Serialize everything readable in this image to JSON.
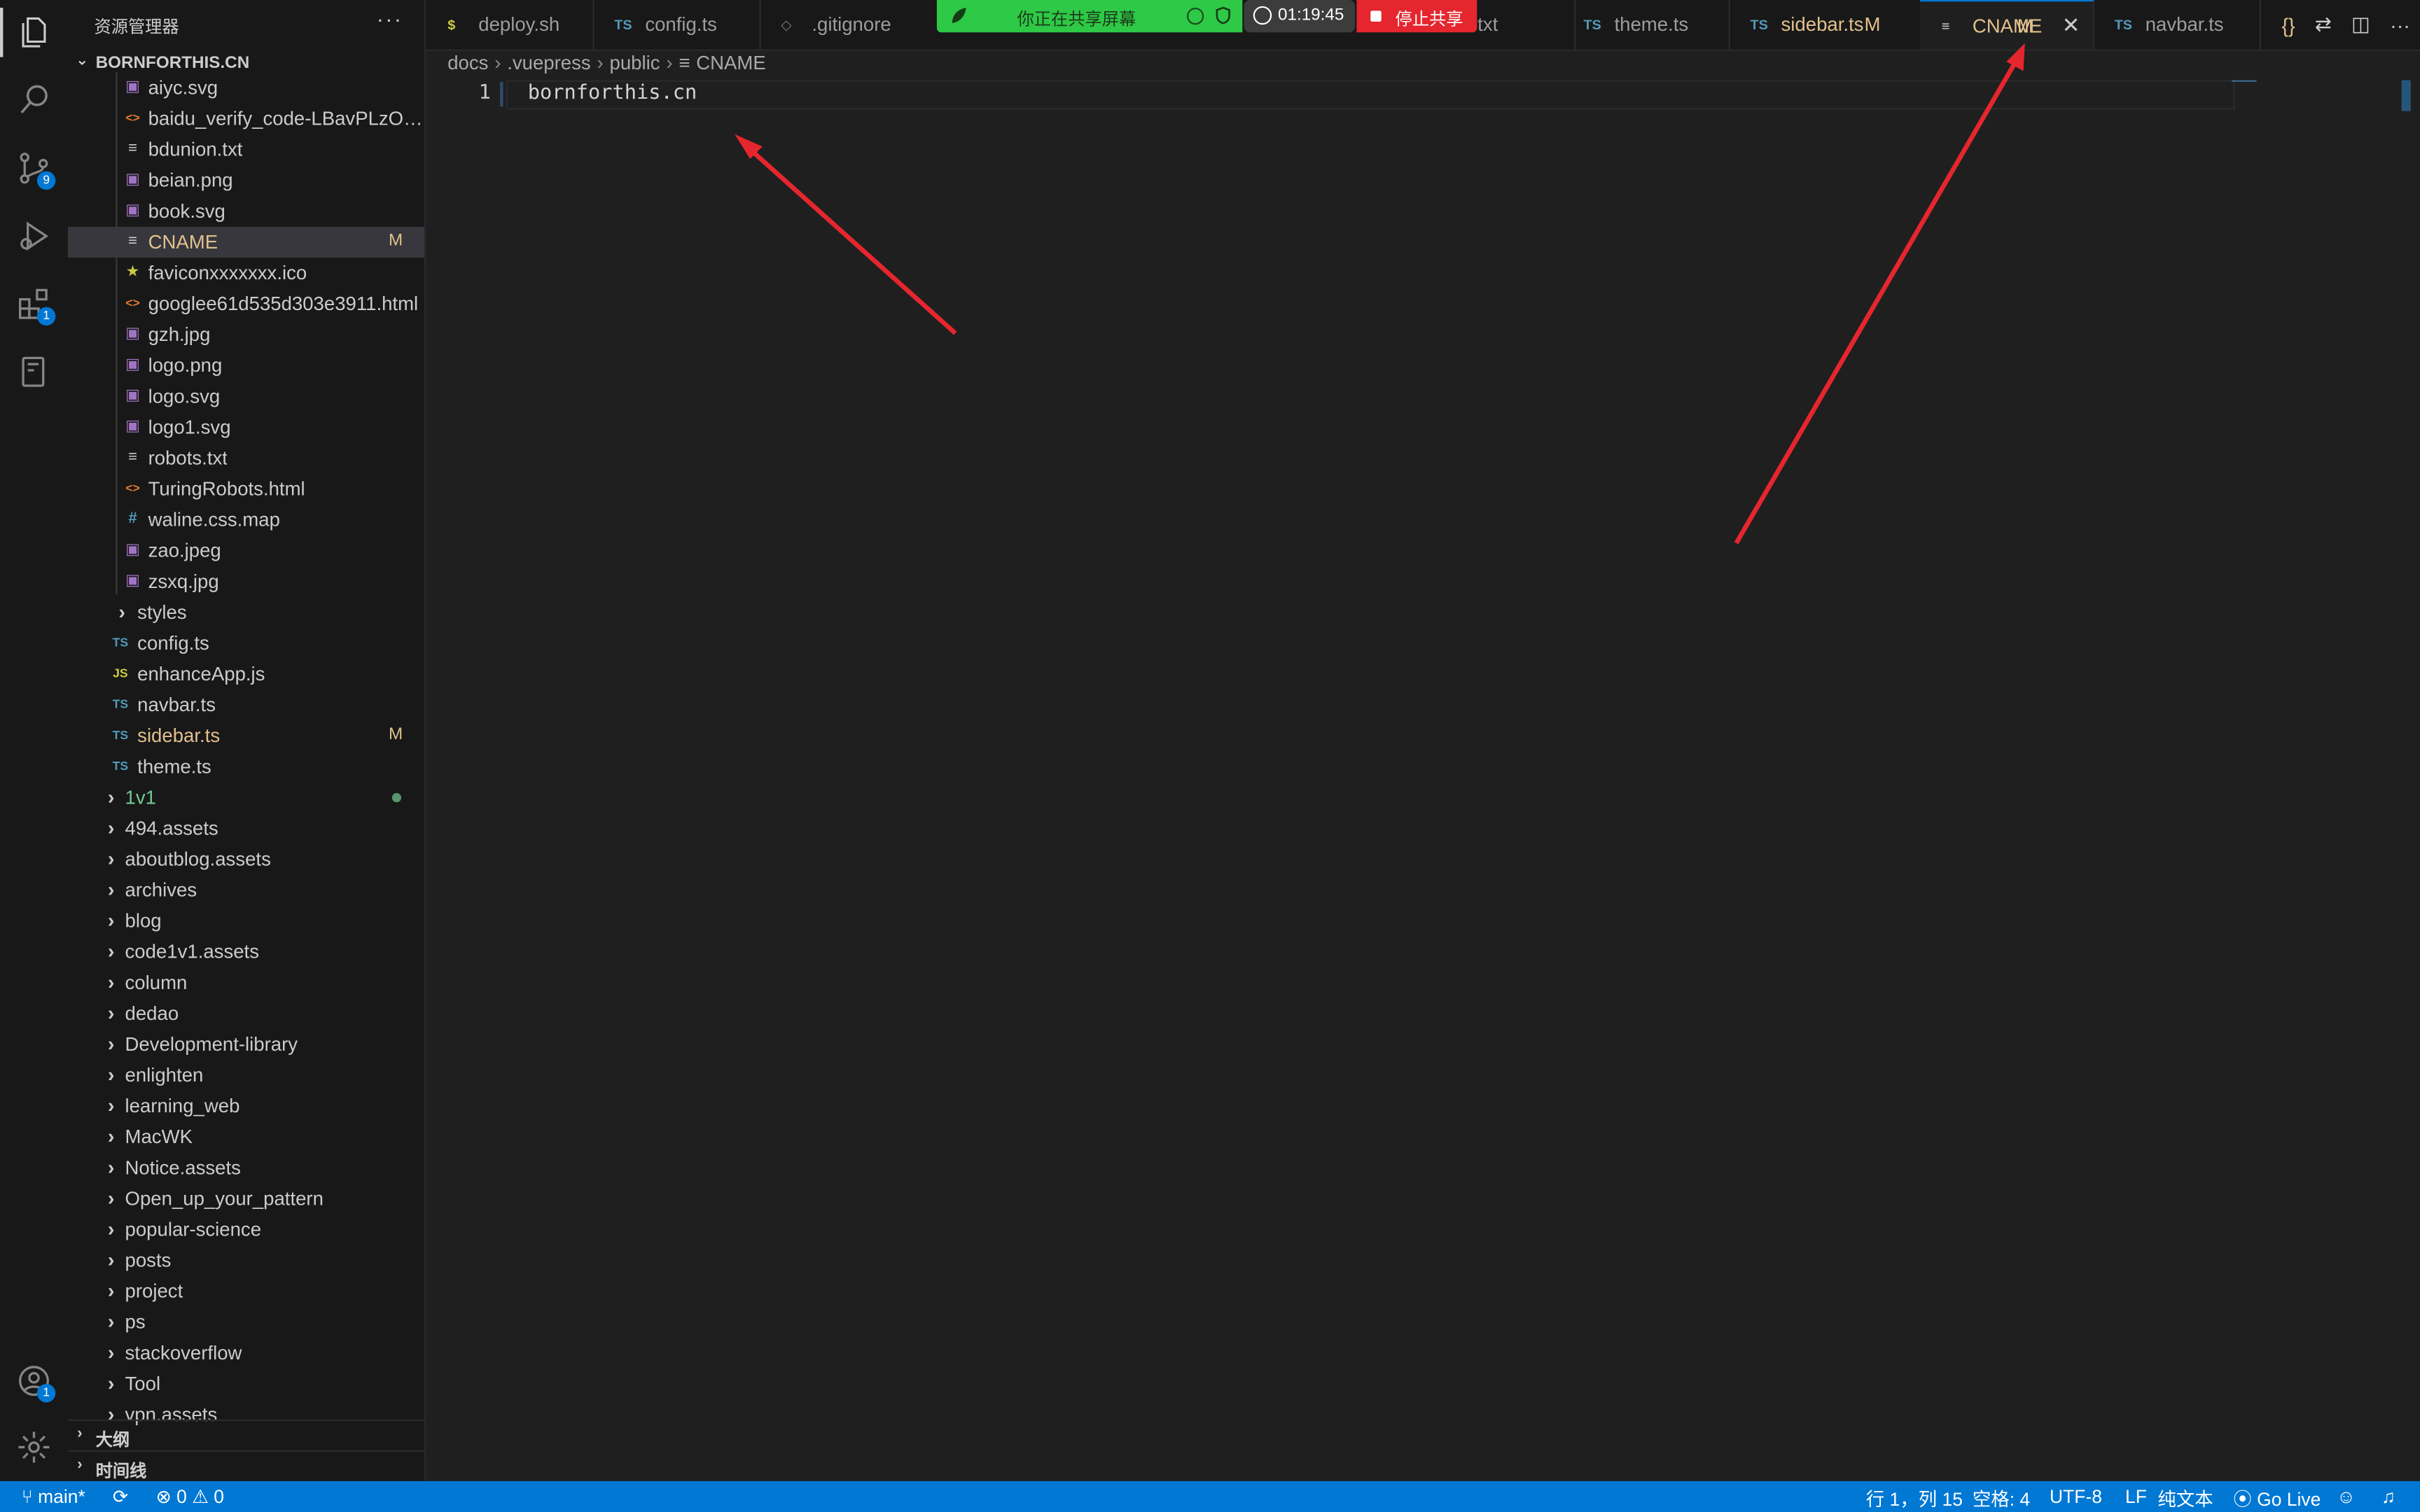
{
  "sidebar": {
    "title": "资源管理器",
    "more": "···",
    "root": "BORNFORTHIS.CN",
    "files": [
      {
        "name": "aiyc.svg",
        "icon": "img",
        "status": ""
      },
      {
        "name": "baidu_verify_code-LBavPLzOe...",
        "icon": "code",
        "status": ""
      },
      {
        "name": "bdunion.txt",
        "icon": "txt",
        "status": ""
      },
      {
        "name": "beian.png",
        "icon": "img",
        "status": ""
      },
      {
        "name": "book.svg",
        "icon": "img",
        "status": ""
      },
      {
        "name": "CNAME",
        "icon": "txt",
        "status": "M"
      },
      {
        "name": "faviconxxxxxxx.ico",
        "icon": "star",
        "status": ""
      },
      {
        "name": "googlee61d535d303e3911.html",
        "icon": "code",
        "status": ""
      },
      {
        "name": "gzh.jpg",
        "icon": "img",
        "status": ""
      },
      {
        "name": "logo.png",
        "icon": "img",
        "status": ""
      },
      {
        "name": "logo.svg",
        "icon": "img",
        "status": ""
      },
      {
        "name": "logo1.svg",
        "icon": "img",
        "status": ""
      },
      {
        "name": "robots.txt",
        "icon": "txt",
        "status": ""
      },
      {
        "name": "TuringRobots.html",
        "icon": "code",
        "status": ""
      },
      {
        "name": "waline.css.map",
        "icon": "hash",
        "status": ""
      },
      {
        "name": "zao.jpeg",
        "icon": "img",
        "status": ""
      },
      {
        "name": "zsxq.jpg",
        "icon": "img",
        "status": ""
      }
    ],
    "vuepress_items": [
      {
        "name": "styles",
        "icon": "folder",
        "status": ""
      },
      {
        "name": "config.ts",
        "icon": "ts",
        "status": ""
      },
      {
        "name": "enhanceApp.js",
        "icon": "js",
        "status": ""
      },
      {
        "name": "navbar.ts",
        "icon": "ts",
        "status": ""
      },
      {
        "name": "sidebar.ts",
        "icon": "ts",
        "status": "M"
      },
      {
        "name": "theme.ts",
        "icon": "ts",
        "status": ""
      }
    ],
    "folders": [
      {
        "name": "1v1",
        "dot": true
      },
      {
        "name": "494.assets"
      },
      {
        "name": "aboutblog.assets"
      },
      {
        "name": "archives"
      },
      {
        "name": "blog"
      },
      {
        "name": "code1v1.assets"
      },
      {
        "name": "column"
      },
      {
        "name": "dedao"
      },
      {
        "name": "Development-library"
      },
      {
        "name": "enlighten"
      },
      {
        "name": "learning_web"
      },
      {
        "name": "MacWK"
      },
      {
        "name": "Notice.assets"
      },
      {
        "name": "Open_up_your_pattern"
      },
      {
        "name": "popular-science"
      },
      {
        "name": "posts"
      },
      {
        "name": "project"
      },
      {
        "name": "ps"
      },
      {
        "name": "stackoverflow"
      },
      {
        "name": "Tool"
      },
      {
        "name": "vpn.assets"
      }
    ],
    "outline": "大纲",
    "timeline": "时间线"
  },
  "activity": {
    "scm_badge": "9",
    "ext_badge": "1",
    "account_badge": "1"
  },
  "tabs": [
    {
      "icon": "$",
      "label": "deploy.sh",
      "status": ""
    },
    {
      "icon": "TS",
      "label": "config.ts",
      "status": ""
    },
    {
      "icon": "◇",
      "label": ".gitignore",
      "status": ""
    },
    {
      "icon": "",
      "label": "na.txt",
      "status": ""
    },
    {
      "icon": "TS",
      "label": "theme.ts",
      "status": ""
    },
    {
      "icon": "TS",
      "label": "sidebar.ts",
      "status": "M"
    },
    {
      "icon": "≡",
      "label": "CNAME",
      "status": "M",
      "close": "✕"
    },
    {
      "icon": "TS",
      "label": "navbar.ts",
      "status": ""
    }
  ],
  "share": {
    "sharing_text": "你正在共享屏幕",
    "timer": "01:19:45",
    "stop_label": "停止共享"
  },
  "breadcrumb": [
    "docs",
    ".vuepress",
    "public",
    "CNAME"
  ],
  "editor": {
    "line_number": "1",
    "content": "bornforthis.cn"
  },
  "status": {
    "branch": "main*",
    "errors": "0",
    "warnings": "0",
    "position": "行 1，列 15",
    "spaces": "空格: 4",
    "encoding": "UTF-8",
    "eol": "LF",
    "language": "纯文本",
    "golive": "Go Live"
  },
  "colors": {
    "accent": "#0078d4",
    "modified": "#e2c08d",
    "annotation": "#e5262e",
    "share_green": "#2ec946"
  }
}
